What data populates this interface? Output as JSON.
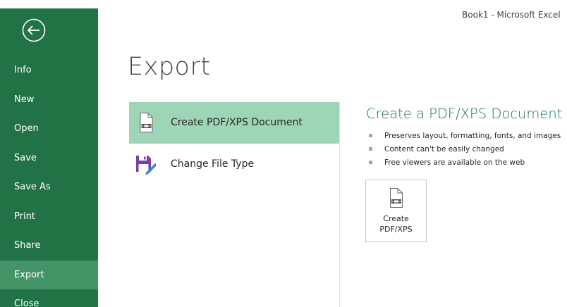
{
  "window": {
    "title": "Book1 - Microsoft Excel"
  },
  "colors": {
    "sidebar": "#217346",
    "sidebar_active": "#439467",
    "selected_option": "#9fd5b7",
    "accent_title": "#217346"
  },
  "sidebar": {
    "back_icon": "back-arrow-icon",
    "items": [
      {
        "label": "Info"
      },
      {
        "label": "New"
      },
      {
        "label": "Open"
      },
      {
        "label": "Save"
      },
      {
        "label": "Save As"
      },
      {
        "label": "Print"
      },
      {
        "label": "Share"
      },
      {
        "label": "Export",
        "active": true
      },
      {
        "label": "Close"
      }
    ]
  },
  "page": {
    "title": "Export"
  },
  "options": [
    {
      "label": "Create PDF/XPS Document",
      "icon": "pdf-document-icon",
      "selected": true
    },
    {
      "label": "Change File Type",
      "icon": "save-as-file-type-icon",
      "selected": false
    }
  ],
  "details": {
    "title": "Create a PDF/XPS Document",
    "bullets": [
      "Preserves layout, formatting, fonts, and images",
      "Content can't be easily changed",
      "Free viewers are available on the web"
    ],
    "button_label": "Create\nPDF/XPS",
    "button_icon": "pdf-document-icon"
  }
}
